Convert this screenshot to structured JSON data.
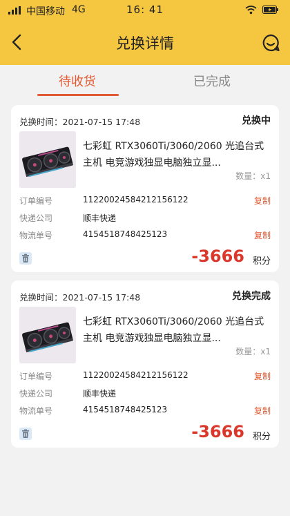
{
  "status_bar": {
    "carrier": "中国移动",
    "network": "4G",
    "time": "16: 41"
  },
  "header": {
    "title": "兑换详情",
    "back_icon": "back-arrow-icon",
    "service_icon": "customer-service-icon"
  },
  "tabs": [
    {
      "label": "待收货",
      "active": true
    },
    {
      "label": "已完成",
      "active": false
    }
  ],
  "colors": {
    "header_bg": "#f5c741",
    "accent": "#e05a33",
    "points": "#d9382b",
    "page_bg": "#f2f2f2"
  },
  "labels": {
    "time_prefix": "兑换时间：",
    "order_no": "订单编号",
    "courier": "快递公司",
    "tracking_no": "物流单号",
    "copy": "复制",
    "points_unit": "积分"
  },
  "orders": [
    {
      "time": "2021-07-15 17:48",
      "status": "兑换中",
      "product_name": "七彩虹 RTX3060Ti/3060/2060 光追台式主机 电竞游戏独显电脑独立显...",
      "quantity": "数量：x1",
      "order_no": "11220024584212156122",
      "courier": "顺丰快递",
      "tracking_no": "4154518748425123",
      "points": "-3666"
    },
    {
      "time": "2021-07-15 17:48",
      "status": "兑换完成",
      "product_name": "七彩虹 RTX3060Ti/3060/2060 光追台式主机 电竞游戏独显电脑独立显...",
      "quantity": "数量：x1",
      "order_no": "11220024584212156122",
      "courier": "顺丰快递",
      "tracking_no": "4154518748425123",
      "points": "-3666"
    }
  ]
}
